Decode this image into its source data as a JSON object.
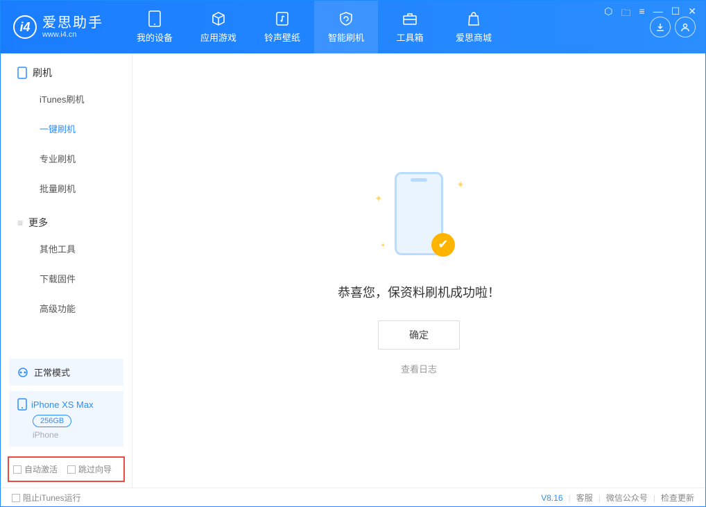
{
  "app": {
    "title": "爱思助手",
    "subtitle": "www.i4.cn"
  },
  "nav": {
    "items": [
      {
        "label": "我的设备"
      },
      {
        "label": "应用游戏"
      },
      {
        "label": "铃声壁纸"
      },
      {
        "label": "智能刷机"
      },
      {
        "label": "工具箱"
      },
      {
        "label": "爱思商城"
      }
    ]
  },
  "sidebar": {
    "section1": "刷机",
    "items1": [
      "iTunes刷机",
      "一键刷机",
      "专业刷机",
      "批量刷机"
    ],
    "section2": "更多",
    "items2": [
      "其他工具",
      "下载固件",
      "高级功能"
    ]
  },
  "mode": {
    "label": "正常模式"
  },
  "device": {
    "name": "iPhone XS Max",
    "capacity": "256GB",
    "type": "iPhone"
  },
  "options": {
    "auto_activate": "自动激活",
    "skip_guide": "跳过向导"
  },
  "main": {
    "message": "恭喜您，保资料刷机成功啦！",
    "confirm": "确定",
    "view_log": "查看日志"
  },
  "footer": {
    "block_itunes": "阻止iTunes运行",
    "version": "V8.16",
    "support": "客服",
    "wechat": "微信公众号",
    "update": "检查更新"
  }
}
